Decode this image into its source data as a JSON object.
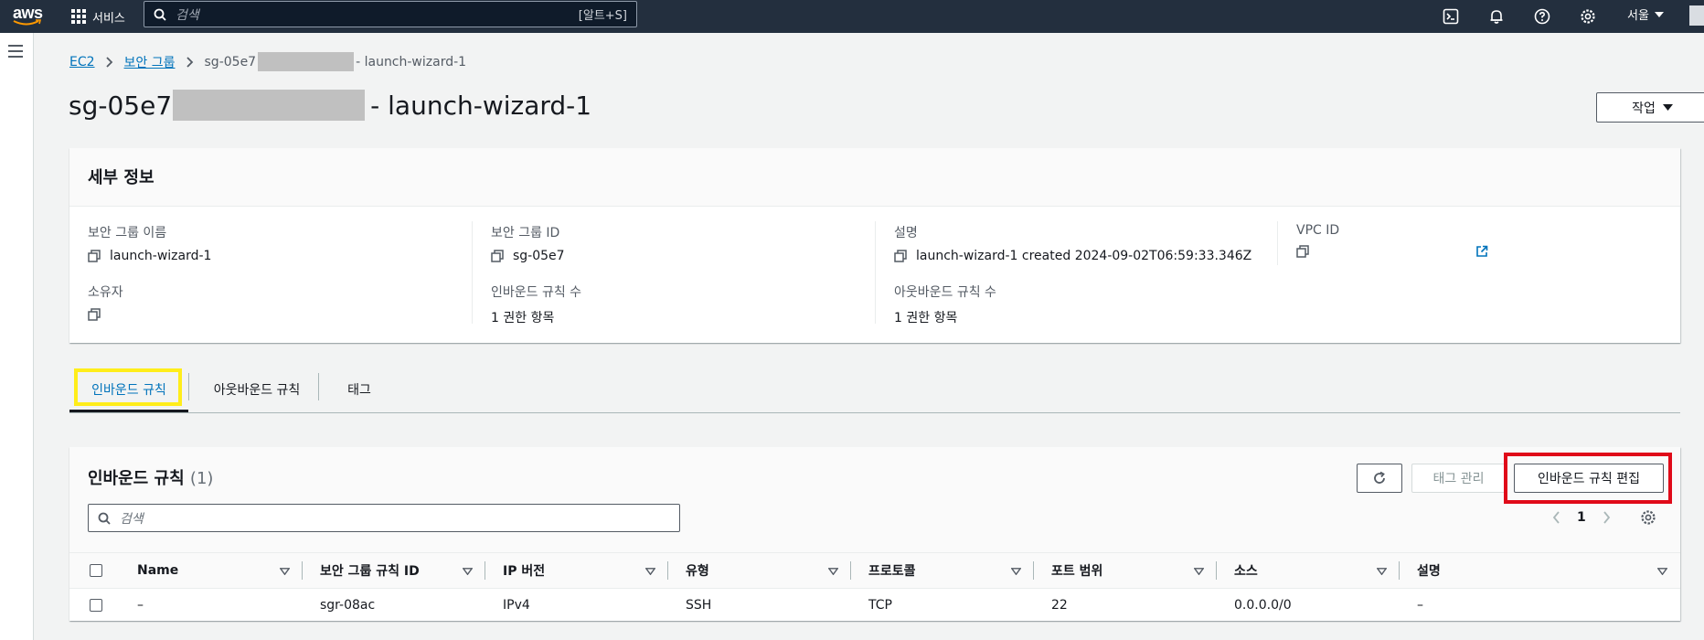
{
  "topnav": {
    "logo_text": "aws",
    "services_label": "서비스",
    "search_placeholder": "검색",
    "search_shortcut": "[알트+S]",
    "region": "서울"
  },
  "breadcrumb": {
    "items": [
      "EC2",
      "보안 그룹"
    ],
    "current_prefix": "sg-05e7",
    "current_suffix": "- launch-wizard-1"
  },
  "page": {
    "title_prefix": "sg-05e7",
    "title_suffix": "- launch-wizard-1",
    "action_label": "작업"
  },
  "details": {
    "title": "세부 정보",
    "fields": {
      "sg_name": {
        "label": "보안 그룹 이름",
        "value": "launch-wizard-1"
      },
      "sg_id": {
        "label": "보안 그룹 ID",
        "value": "sg-05e7"
      },
      "description": {
        "label": "설명",
        "value": "launch-wizard-1 created 2024-09-02T06:59:33.346Z"
      },
      "vpc_id": {
        "label": "VPC ID",
        "value": ""
      },
      "owner": {
        "label": "소유자",
        "value": ""
      },
      "inbound_count": {
        "label": "인바운드 규칙 수",
        "value": "1 권한 항목"
      },
      "outbound_count": {
        "label": "아웃바운드 규칙 수",
        "value": "1 권한 항목"
      }
    }
  },
  "tabs": [
    "인바운드 규칙",
    "아웃바운드 규칙",
    "태그"
  ],
  "rules": {
    "title": "인바운드 규칙",
    "count": "(1)",
    "tag_manage_label": "태그 관리",
    "edit_label": "인바운드 규칙 편집",
    "search_placeholder": "검색",
    "page_number": "1",
    "columns": [
      "Name",
      "보안 그룹 규칙 ID",
      "IP 버전",
      "유형",
      "프로토콜",
      "포트 범위",
      "소스",
      "설명"
    ],
    "rows": [
      [
        "–",
        "sgr-08ac",
        "IPv4",
        "SSH",
        "TCP",
        "22",
        "0.0.0.0/0",
        "–"
      ]
    ]
  },
  "colors": {
    "nav_bg": "#232f3e",
    "link": "#0073bb",
    "highlight_yellow": "#ffed1a",
    "highlight_red": "#e00a19"
  }
}
